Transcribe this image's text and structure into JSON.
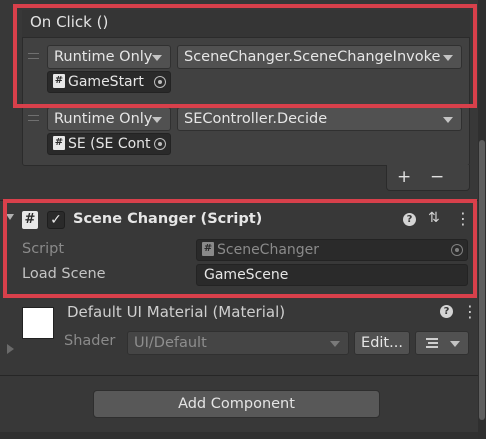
{
  "onclick": {
    "header": "On Click ()",
    "events": [
      {
        "runtime": "Runtime Only",
        "function": "SceneChanger.SceneChangeInvoke",
        "target": "GameStart"
      },
      {
        "runtime": "Runtime Only",
        "function": "SEController.Decide",
        "target": "SE (SE Cont"
      }
    ],
    "add_symbol": "+",
    "remove_symbol": "−"
  },
  "component": {
    "title": "Scene Changer (Script)",
    "script_label": "Script",
    "script_value": "SceneChanger",
    "load_scene_label": "Load Scene",
    "load_scene_value": "GameScene"
  },
  "material": {
    "title": "Default UI Material (Material)",
    "shader_label": "Shader",
    "shader_value": "UI/Default",
    "edit_label": "Edit..."
  },
  "add_component_label": "Add Component",
  "colors": {
    "highlight": "#d8404b",
    "background": "#383838"
  }
}
